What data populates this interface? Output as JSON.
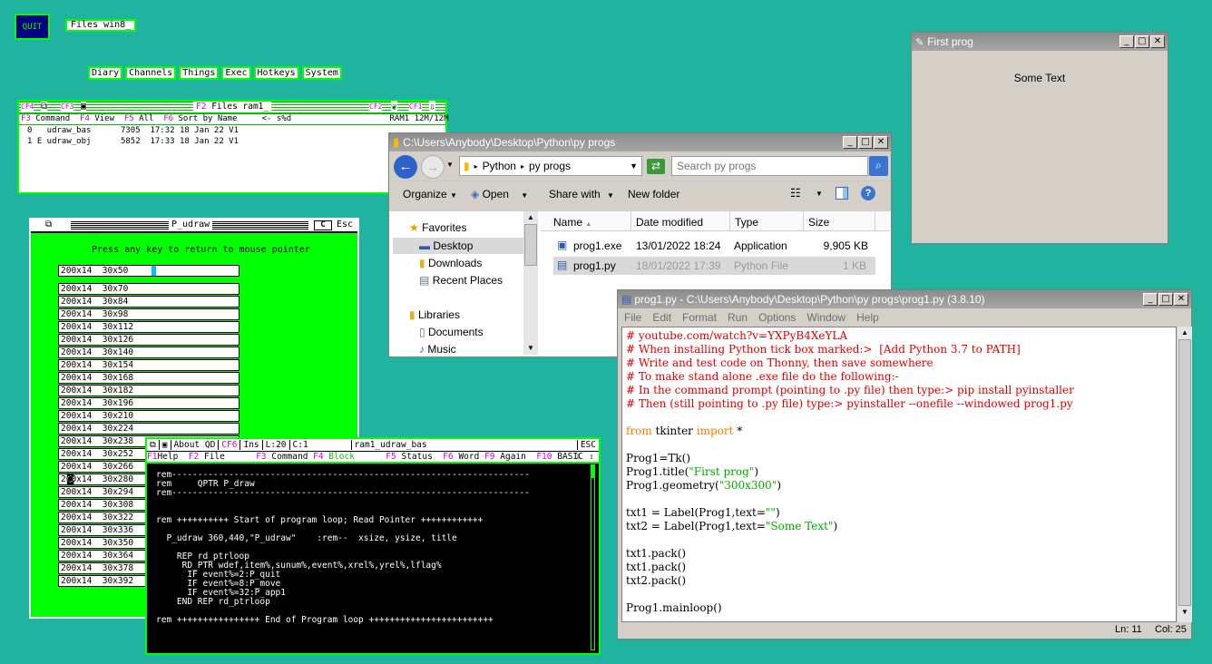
{
  "ql": {
    "quit": "QUIT",
    "files_title": "Files win8_",
    "menu": [
      "Diary",
      "Channels",
      "Things",
      "Exec",
      "Hotkeys",
      "System"
    ]
  },
  "files_window": {
    "keys": {
      "cf4": "CF4",
      "cf3": "CF3",
      "cf2": "CF2",
      "cf1": "CF1",
      "f2": "F2"
    },
    "title": "Files ram1_",
    "header": {
      "f3": "F3",
      "command": "Command",
      "f4": "F4",
      "view": "View",
      "f5": "F5",
      "all": "All",
      "f6": "F6",
      "sort": "Sort by Name",
      "back": "<- s%d",
      "device": "RAM1 12M/12M"
    },
    "rows": [
      "0   udraw_bas      7305  17:32 18 Jan 22 V1",
      "1 E udraw_obj      5852  17:33 18 Jan 22 V1"
    ]
  },
  "pudraw": {
    "title": "P_udraw",
    "esc": "Esc",
    "message": "Press any key to return to mouse pointer",
    "first_item": "200x14  30x50",
    "items": [
      "200x14  30x70",
      "200x14  30x84",
      "200x14  30x98",
      "200x14  30x112",
      "200x14  30x126",
      "200x14  30x140",
      "200x14  30x154",
      "200x14  30x168",
      "200x14  30x182",
      "200x14  30x196",
      "200x14  30x210",
      "200x14  30x224",
      "200x14  30x238",
      "200x14  30x252",
      "200x14  30x266",
      "200x14  30x280",
      "200x14  30x294",
      "200x14  30x308",
      "200x14  30x322",
      "200x14  30x336",
      "200x14  30x350",
      "200x14  30x364",
      "200x14  30x378",
      "200x14  30x392"
    ]
  },
  "editor": {
    "about": "About QD",
    "cf6": "CF6",
    "ins": "Ins",
    "line": "L:20",
    "col": "C:1",
    "file": "ram1_udraw_bas",
    "esc": "ESC",
    "fkeys": {
      "f1": "F1",
      "help": "Help",
      "f2": "F2",
      "file": "File",
      "f3": "F3",
      "command": "Command",
      "f4": "F4",
      "block": "Block",
      "f5": "F5",
      "status": "Status",
      "f6": "F6",
      "word": "Word",
      "f9": "F9",
      "again": "Again",
      "f10": "F10",
      "basic": "BASIC"
    },
    "code": "rem---------------------------------------------------------------------\nrem     QPTR P_draw\nrem---------------------------------------------------------------------\n\n\nrem ++++++++++ Start of program loop; Read Pointer ++++++++++++\n\n  P_udraw 360,440,\"P_udraw\"    :rem--  xsize, ysize, title\n\n    REP rd_ptrloop\n     RD_PTR wdef,item%,sunum%,event%,xrel%,yrel%,lflag%\n      IF event%=2:P_quit\n      IF event%=8:P_move\n      IF event%=32:P_app1\n    END REP rd_ptrloop\n\nrem ++++++++++++++++ End of Program loop ++++++++++++++++++++++++"
  },
  "explorer": {
    "title": "C:\\Users\\Anybody\\Desktop\\Python\\py progs",
    "crumbs": [
      "Python",
      "py progs"
    ],
    "search_placeholder": "Search py progs",
    "toolbar": {
      "organize": "Organize",
      "open": "Open",
      "share": "Share with",
      "new_folder": "New folder"
    },
    "nav": {
      "favorites": "Favorites",
      "desktop": "Desktop",
      "downloads": "Downloads",
      "recent": "Recent Places",
      "libraries": "Libraries",
      "documents": "Documents",
      "music": "Music"
    },
    "columns": {
      "name": "Name",
      "date": "Date modified",
      "type": "Type",
      "size": "Size"
    },
    "files": [
      {
        "name": "prog1.exe",
        "date": "13/01/2022 18:24",
        "type": "Application",
        "size": "9,905 KB"
      },
      {
        "name": "prog1.py",
        "date": "18/01/2022 17:39",
        "type": "Python File",
        "size": "1 KB"
      }
    ]
  },
  "first_prog": {
    "title": "First prog",
    "text": "Some Text"
  },
  "idle": {
    "title": "prog1.py - C:\\Users\\Anybody\\Desktop\\Python\\py progs\\prog1.py (3.8.10)",
    "menu": [
      "File",
      "Edit",
      "Format",
      "Run",
      "Options",
      "Window",
      "Help"
    ],
    "comments": [
      "# youtube.com/watch?v=YXPyB4XeYLA",
      "# When installing Python tick box marked:>  [Add Python 3.7 to PATH]",
      "# Write and test code on Thonny, then save somewhere",
      "# To make stand alone .exe file do the following:-",
      "# In the command prompt (pointing to .py file) then type:> pip install pyinstaller",
      "# Then (still pointing to .py file) type:> pyinstaller --onefile --windowed prog1.py"
    ],
    "import_from": "from",
    "import_mod": " tkinter ",
    "import_kw": "import",
    "import_rest": " *",
    "l_tk": "Prog1=Tk()",
    "l_title_a": "Prog1.title(",
    "l_title_s": "\"First prog\"",
    "l_geo_a": "Prog1.geometry(",
    "l_geo_s": "\"300x300\"",
    "l_close": ")",
    "l_t1_a": "txt1 = Label(Prog1,text=",
    "l_t1_s": "\"\"",
    "l_t2_a": "txt2 = Label(Prog1,text=",
    "l_t2_s": "\"Some Text\"",
    "packs": [
      "txt1.pack()",
      "txt1.pack()",
      "txt2.pack()"
    ],
    "l_main": "Prog1.mainloop()",
    "status_ln": "Ln: 11",
    "status_col": "Col: 25"
  }
}
